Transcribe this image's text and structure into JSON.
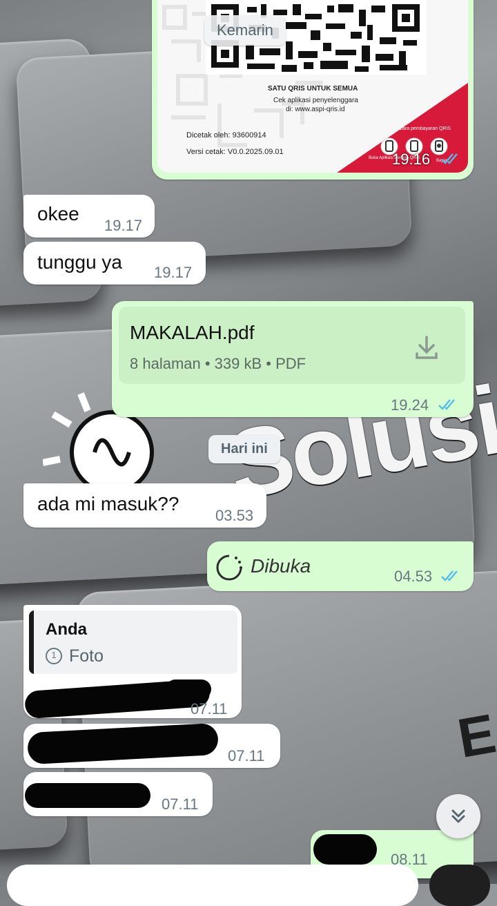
{
  "chat": {
    "date_kemarin": "Kemarin",
    "date_hari_ini": "Hari ini",
    "qris": {
      "tagline": "SATU QRIS UNTUK SEMUA",
      "line1": "Cek aplikasi penyelenggara",
      "line2": "di: www.aspi-qris.id",
      "printed_by": "Dicetak oleh: 93600914",
      "print_version": "Versi cetak: V0.0.2025.09.01",
      "pay_method": "Cara pembayaran QRIS",
      "step_note": "Buka Aplikasi Berlogo QRIS",
      "step_note2": "Bayar",
      "time": "19.16"
    },
    "m1": {
      "text": "okee",
      "time": "19.17"
    },
    "m2": {
      "text": "tunggu ya",
      "time": "19.17"
    },
    "doc": {
      "filename": "MAKALAH.pdf",
      "meta": "8 halaman • 339 kB • PDF",
      "time": "19.24"
    },
    "m3": {
      "text": "ada mi masuk??",
      "time": "03.53"
    },
    "m4": {
      "text": "Dibuka",
      "time": "04.53"
    },
    "reply": {
      "author": "Anda",
      "type": "Foto",
      "view_once_mark": "1",
      "time": "07.11"
    },
    "m6": {
      "time": "07.11"
    },
    "m7": {
      "time": "07.11"
    },
    "m8": {
      "time": "08.11"
    }
  },
  "watermark": {
    "word": "Solusi",
    "letter": "E"
  }
}
